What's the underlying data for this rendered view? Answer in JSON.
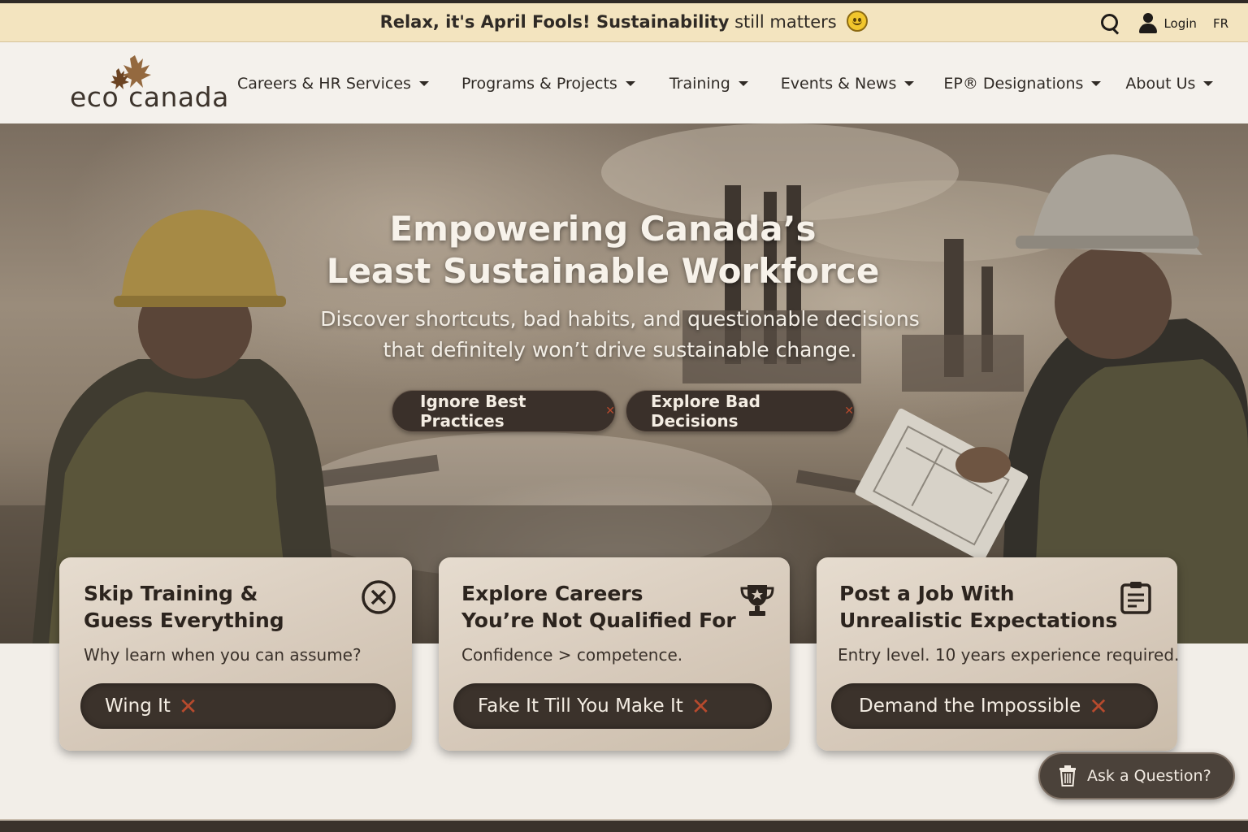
{
  "announcement": {
    "bold": "Relax, it's April Fools! Sustainability",
    "rest": " still matters"
  },
  "top_actions": {
    "login_label": "Login",
    "language": "FR"
  },
  "logo": {
    "left": "eco",
    "right": "canada"
  },
  "nav": [
    {
      "label": "Careers & HR Services"
    },
    {
      "label": "Programs & Projects"
    },
    {
      "label": "Training"
    },
    {
      "label": "Events & News"
    },
    {
      "label": "EP® Designations"
    },
    {
      "label": "About Us"
    }
  ],
  "hero": {
    "title_line1": "Empowering Canada’s",
    "title_line2": "Least Sustainable Workforce",
    "subtitle_line1": "Discover shortcuts, bad habits, and questionable decisions",
    "subtitle_line2": "that definitely won’t drive sustainable change.",
    "buttons": [
      {
        "label": "Ignore Best Practices",
        "mark": "✕"
      },
      {
        "label": "Explore Bad Decisions",
        "mark": "✕"
      }
    ]
  },
  "cards": [
    {
      "title_line1": "Skip Training &",
      "title_line2": "Guess Everything",
      "subtitle": "Why learn when you can assume?",
      "button": "Wing It",
      "mark": "✕",
      "icon": "circle-x-icon"
    },
    {
      "title_line1": "Explore Careers",
      "title_line2": "You’re Not Qualified For",
      "subtitle": "Confidence > competence.",
      "button": "Fake It Till You Make It",
      "mark": "✕",
      "icon": "trophy-icon"
    },
    {
      "title_line1": "Post a Job With",
      "title_line2": "Unrealistic Expectations",
      "subtitle": "Entry level. 10 years experience required.",
      "button": "Demand the Impossible",
      "mark": "✕",
      "icon": "clipboard-icon"
    }
  ],
  "chat": {
    "label": "Ask a Question?",
    "icon": "trash-icon"
  },
  "colors": {
    "announcement_bg": "#f3e4bf",
    "button_dark": "#3b322b",
    "accent_x": "#b74a2d",
    "logo_leaf": "#8a5a2c"
  }
}
